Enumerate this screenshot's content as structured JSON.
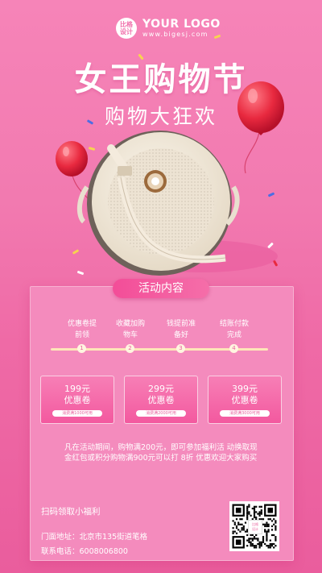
{
  "header": {
    "logo_badge": "比格\n设计",
    "logo_text": "YOUR LOGO",
    "logo_url": "www.bigesj.com"
  },
  "title": "女王购物节",
  "subtitle": "购物大狂欢",
  "section_title": "活动内容",
  "steps": [
    {
      "number": "1",
      "label": "优惠卷提\n前领"
    },
    {
      "number": "2",
      "label": "收藏加购\n物车"
    },
    {
      "number": "3",
      "label": "钱提前准\n备好"
    },
    {
      "number": "4",
      "label": "结账付款\n完成"
    }
  ],
  "coupons": [
    {
      "amount": "199元",
      "name": "优惠卷",
      "condition": "消费满1000可用"
    },
    {
      "amount": "299元",
      "name": "优惠卷",
      "condition": "消费满2000可用"
    },
    {
      "amount": "399元",
      "name": "优惠卷",
      "condition": "消费满3000可用"
    }
  ],
  "description": "凡在活动期间，购物满200元，即可参加福利活 动换取现金红包或积分购物满900元可以打 8折 优惠欢迎大家购买",
  "qr_caption": "扫码领取小福利",
  "address_label": "门面地址：",
  "address": "北京市135街道笔格",
  "phone_label": "联系电话：",
  "phone": "6008006800",
  "qr_center_text": "比格\n设计",
  "colors": {
    "background": "#f27ab0",
    "accent": "#f34d98",
    "balloon": "#e8293f",
    "timeline": "#fde6b8"
  }
}
